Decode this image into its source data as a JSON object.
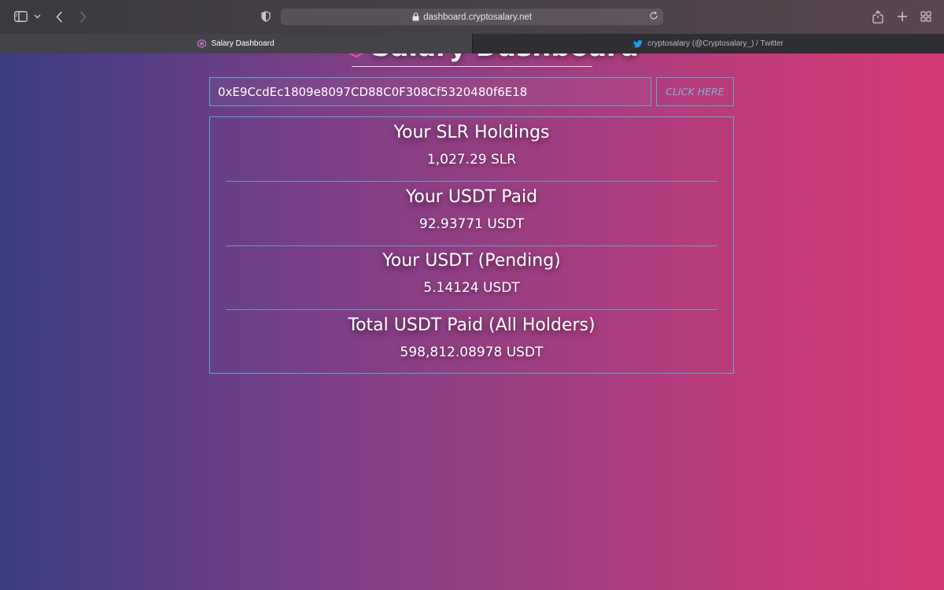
{
  "browser": {
    "url": "dashboard.cryptosalary.net",
    "tabs": [
      {
        "label": "Salary Dashboard",
        "active": true,
        "favicon": "salary-logo-icon"
      },
      {
        "label": "cryptosalary (@Cryptosalary_) / Twitter",
        "active": false,
        "favicon": "twitter-bird-icon"
      }
    ]
  },
  "page": {
    "title": "Salary Dashboard",
    "wallet_address": "0xE9CcdEc1809e8097CD88C0F308Cf5320480f6E18",
    "button_label": "CLICK HERE",
    "stats": [
      {
        "label": "Your SLR Holdings",
        "value": "1,027.29 SLR"
      },
      {
        "label": "Your USDT Paid",
        "value": "92.93771 USDT"
      },
      {
        "label": "Your USDT (Pending)",
        "value": "5.14124 USDT"
      },
      {
        "label": "Total USDT Paid (All Holders)",
        "value": "598,812.08978 USDT"
      }
    ]
  },
  "colors": {
    "accent_border": "#5fa8cf",
    "button_text": "#7ab3d3",
    "gradient_left": "#3b3e82",
    "gradient_right": "#d63a78",
    "twitter_blue": "#1d9bf0"
  }
}
